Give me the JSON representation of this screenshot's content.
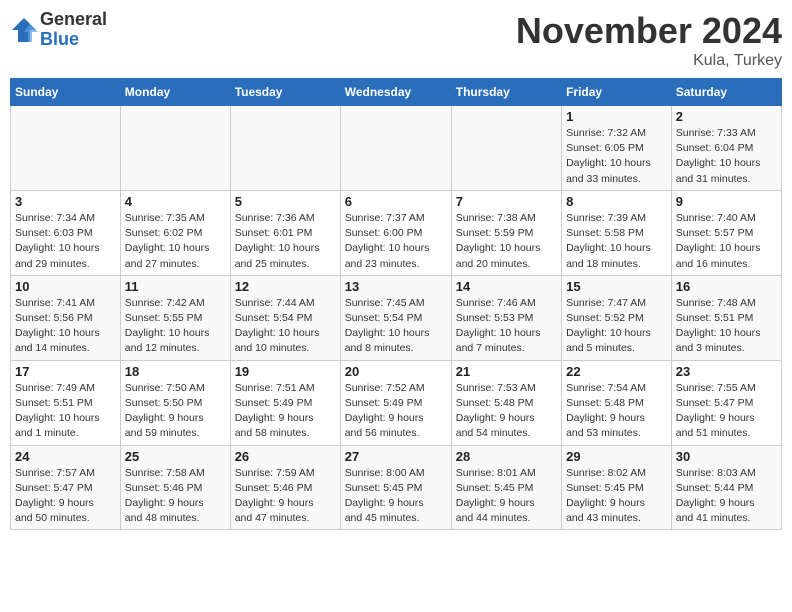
{
  "header": {
    "logo_general": "General",
    "logo_blue": "Blue",
    "month_title": "November 2024",
    "location": "Kula, Turkey"
  },
  "weekdays": [
    "Sunday",
    "Monday",
    "Tuesday",
    "Wednesday",
    "Thursday",
    "Friday",
    "Saturday"
  ],
  "weeks": [
    [
      {
        "day": "",
        "info": ""
      },
      {
        "day": "",
        "info": ""
      },
      {
        "day": "",
        "info": ""
      },
      {
        "day": "",
        "info": ""
      },
      {
        "day": "",
        "info": ""
      },
      {
        "day": "1",
        "info": "Sunrise: 7:32 AM\nSunset: 6:05 PM\nDaylight: 10 hours\nand 33 minutes."
      },
      {
        "day": "2",
        "info": "Sunrise: 7:33 AM\nSunset: 6:04 PM\nDaylight: 10 hours\nand 31 minutes."
      }
    ],
    [
      {
        "day": "3",
        "info": "Sunrise: 7:34 AM\nSunset: 6:03 PM\nDaylight: 10 hours\nand 29 minutes."
      },
      {
        "day": "4",
        "info": "Sunrise: 7:35 AM\nSunset: 6:02 PM\nDaylight: 10 hours\nand 27 minutes."
      },
      {
        "day": "5",
        "info": "Sunrise: 7:36 AM\nSunset: 6:01 PM\nDaylight: 10 hours\nand 25 minutes."
      },
      {
        "day": "6",
        "info": "Sunrise: 7:37 AM\nSunset: 6:00 PM\nDaylight: 10 hours\nand 23 minutes."
      },
      {
        "day": "7",
        "info": "Sunrise: 7:38 AM\nSunset: 5:59 PM\nDaylight: 10 hours\nand 20 minutes."
      },
      {
        "day": "8",
        "info": "Sunrise: 7:39 AM\nSunset: 5:58 PM\nDaylight: 10 hours\nand 18 minutes."
      },
      {
        "day": "9",
        "info": "Sunrise: 7:40 AM\nSunset: 5:57 PM\nDaylight: 10 hours\nand 16 minutes."
      }
    ],
    [
      {
        "day": "10",
        "info": "Sunrise: 7:41 AM\nSunset: 5:56 PM\nDaylight: 10 hours\nand 14 minutes."
      },
      {
        "day": "11",
        "info": "Sunrise: 7:42 AM\nSunset: 5:55 PM\nDaylight: 10 hours\nand 12 minutes."
      },
      {
        "day": "12",
        "info": "Sunrise: 7:44 AM\nSunset: 5:54 PM\nDaylight: 10 hours\nand 10 minutes."
      },
      {
        "day": "13",
        "info": "Sunrise: 7:45 AM\nSunset: 5:54 PM\nDaylight: 10 hours\nand 8 minutes."
      },
      {
        "day": "14",
        "info": "Sunrise: 7:46 AM\nSunset: 5:53 PM\nDaylight: 10 hours\nand 7 minutes."
      },
      {
        "day": "15",
        "info": "Sunrise: 7:47 AM\nSunset: 5:52 PM\nDaylight: 10 hours\nand 5 minutes."
      },
      {
        "day": "16",
        "info": "Sunrise: 7:48 AM\nSunset: 5:51 PM\nDaylight: 10 hours\nand 3 minutes."
      }
    ],
    [
      {
        "day": "17",
        "info": "Sunrise: 7:49 AM\nSunset: 5:51 PM\nDaylight: 10 hours\nand 1 minute."
      },
      {
        "day": "18",
        "info": "Sunrise: 7:50 AM\nSunset: 5:50 PM\nDaylight: 9 hours\nand 59 minutes."
      },
      {
        "day": "19",
        "info": "Sunrise: 7:51 AM\nSunset: 5:49 PM\nDaylight: 9 hours\nand 58 minutes."
      },
      {
        "day": "20",
        "info": "Sunrise: 7:52 AM\nSunset: 5:49 PM\nDaylight: 9 hours\nand 56 minutes."
      },
      {
        "day": "21",
        "info": "Sunrise: 7:53 AM\nSunset: 5:48 PM\nDaylight: 9 hours\nand 54 minutes."
      },
      {
        "day": "22",
        "info": "Sunrise: 7:54 AM\nSunset: 5:48 PM\nDaylight: 9 hours\nand 53 minutes."
      },
      {
        "day": "23",
        "info": "Sunrise: 7:55 AM\nSunset: 5:47 PM\nDaylight: 9 hours\nand 51 minutes."
      }
    ],
    [
      {
        "day": "24",
        "info": "Sunrise: 7:57 AM\nSunset: 5:47 PM\nDaylight: 9 hours\nand 50 minutes."
      },
      {
        "day": "25",
        "info": "Sunrise: 7:58 AM\nSunset: 5:46 PM\nDaylight: 9 hours\nand 48 minutes."
      },
      {
        "day": "26",
        "info": "Sunrise: 7:59 AM\nSunset: 5:46 PM\nDaylight: 9 hours\nand 47 minutes."
      },
      {
        "day": "27",
        "info": "Sunrise: 8:00 AM\nSunset: 5:45 PM\nDaylight: 9 hours\nand 45 minutes."
      },
      {
        "day": "28",
        "info": "Sunrise: 8:01 AM\nSunset: 5:45 PM\nDaylight: 9 hours\nand 44 minutes."
      },
      {
        "day": "29",
        "info": "Sunrise: 8:02 AM\nSunset: 5:45 PM\nDaylight: 9 hours\nand 43 minutes."
      },
      {
        "day": "30",
        "info": "Sunrise: 8:03 AM\nSunset: 5:44 PM\nDaylight: 9 hours\nand 41 minutes."
      }
    ]
  ]
}
